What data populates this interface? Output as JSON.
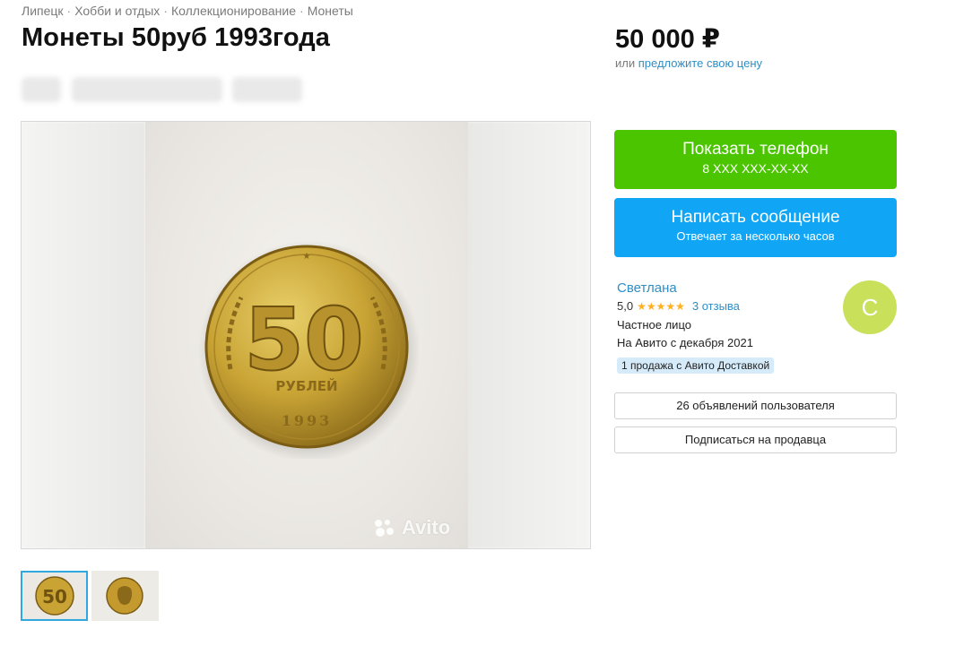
{
  "breadcrumbs": [
    "Липецк",
    "Хобби и отдых",
    "Коллекционирование",
    "Монеты"
  ],
  "breadcrumb_separator": "·",
  "title": "Монеты 50руб 1993года",
  "price": "50 000 ₽",
  "offer": {
    "prefix": "или",
    "link": "предложите свою цену"
  },
  "gallery": {
    "watermark": "Avito",
    "coin_denomination": "50",
    "coin_text": "РУБЛЕЙ",
    "coin_year": "1993",
    "thumbnails": [
      "coin-reverse",
      "coin-obverse"
    ],
    "active_thumbnail": 0
  },
  "actions": {
    "phone_label": "Показать телефон",
    "phone_number": "8 XXX XXX-XX-XX",
    "message_label": "Написать сообщение",
    "message_sub": "Отвечает за несколько часов"
  },
  "seller": {
    "name": "Светлана",
    "rating": "5,0",
    "stars": "★★★★★",
    "reviews": "3 отзыва",
    "type": "Частное лицо",
    "since": "На Авито с декабря 2021",
    "badge": "1 продажа с Авито Доставкой",
    "avatar_letter": "С",
    "avatar_color": "#c8e05a"
  },
  "buttons": {
    "listings": "26 объявлений пользователя",
    "subscribe": "Подписаться на продавца"
  },
  "colors": {
    "phone_button": "#4ac500",
    "message_button": "#10a6f5",
    "link": "#2f8fc4",
    "star": "#ffb021"
  }
}
